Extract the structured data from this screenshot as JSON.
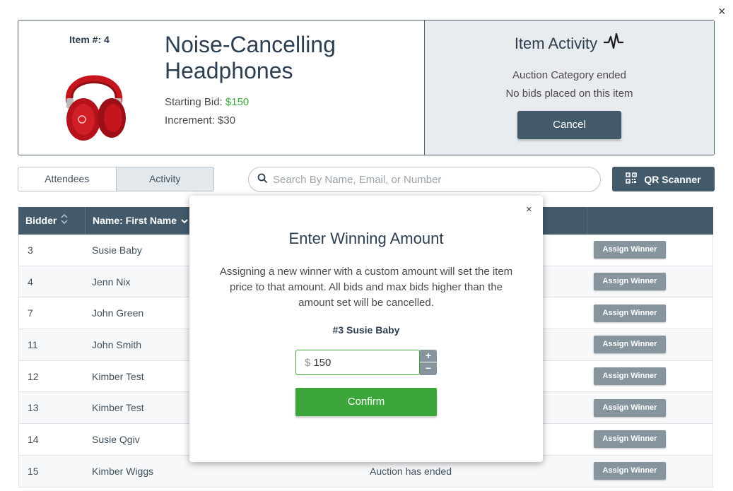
{
  "close_label": "×",
  "item": {
    "number_label": "Item #: 4",
    "title": "Noise-Cancelling Headphones",
    "starting_bid_label": "Starting Bid: ",
    "starting_bid_value": "$150",
    "increment_label": "Increment: $30",
    "image_icon": "red-headphones-image"
  },
  "activity": {
    "title": "Item Activity",
    "line1": "Auction Category ended",
    "line2": "No bids placed on this item",
    "cancel_label": "Cancel"
  },
  "tabs": [
    {
      "label": "Attendees"
    },
    {
      "label": "Activity"
    }
  ],
  "search": {
    "placeholder": "Search By Name, Email, or Number"
  },
  "qr_label": "QR Scanner",
  "table": {
    "headers": {
      "bidder": "Bidder",
      "name": "Name:  First Name"
    },
    "rows": [
      {
        "bidder": "3",
        "name": "Susie Baby",
        "status": "",
        "action": "Assign Winner"
      },
      {
        "bidder": "4",
        "name": "Jenn Nix",
        "status": "",
        "action": "Assign Winner"
      },
      {
        "bidder": "7",
        "name": "John Green",
        "status": "",
        "action": "Assign Winner"
      },
      {
        "bidder": "11",
        "name": "John Smith",
        "status": "",
        "action": "Assign Winner"
      },
      {
        "bidder": "12",
        "name": "Kimber Test",
        "status": "",
        "action": "Assign Winner"
      },
      {
        "bidder": "13",
        "name": "Kimber Test",
        "status": "",
        "action": "Assign Winner"
      },
      {
        "bidder": "14",
        "name": "Susie Qgiv",
        "status": "",
        "action": "Assign Winner"
      },
      {
        "bidder": "15",
        "name": "Kimber Wiggs",
        "status": "Auction has ended",
        "action": "Assign Winner"
      }
    ]
  },
  "modal": {
    "close_label": "×",
    "title": "Enter Winning Amount",
    "body": "Assigning a new winner with a custom amount will set the item price to that amount. All bids and max bids higher than the amount set will be cancelled.",
    "bidder": "#3 Susie Baby",
    "currency": "$",
    "amount": "150",
    "plus": "+",
    "minus": "−",
    "confirm_label": "Confirm"
  },
  "colors": {
    "primary": "#435a6b",
    "green": "#3ca63c",
    "muted_button": "#86949e"
  }
}
